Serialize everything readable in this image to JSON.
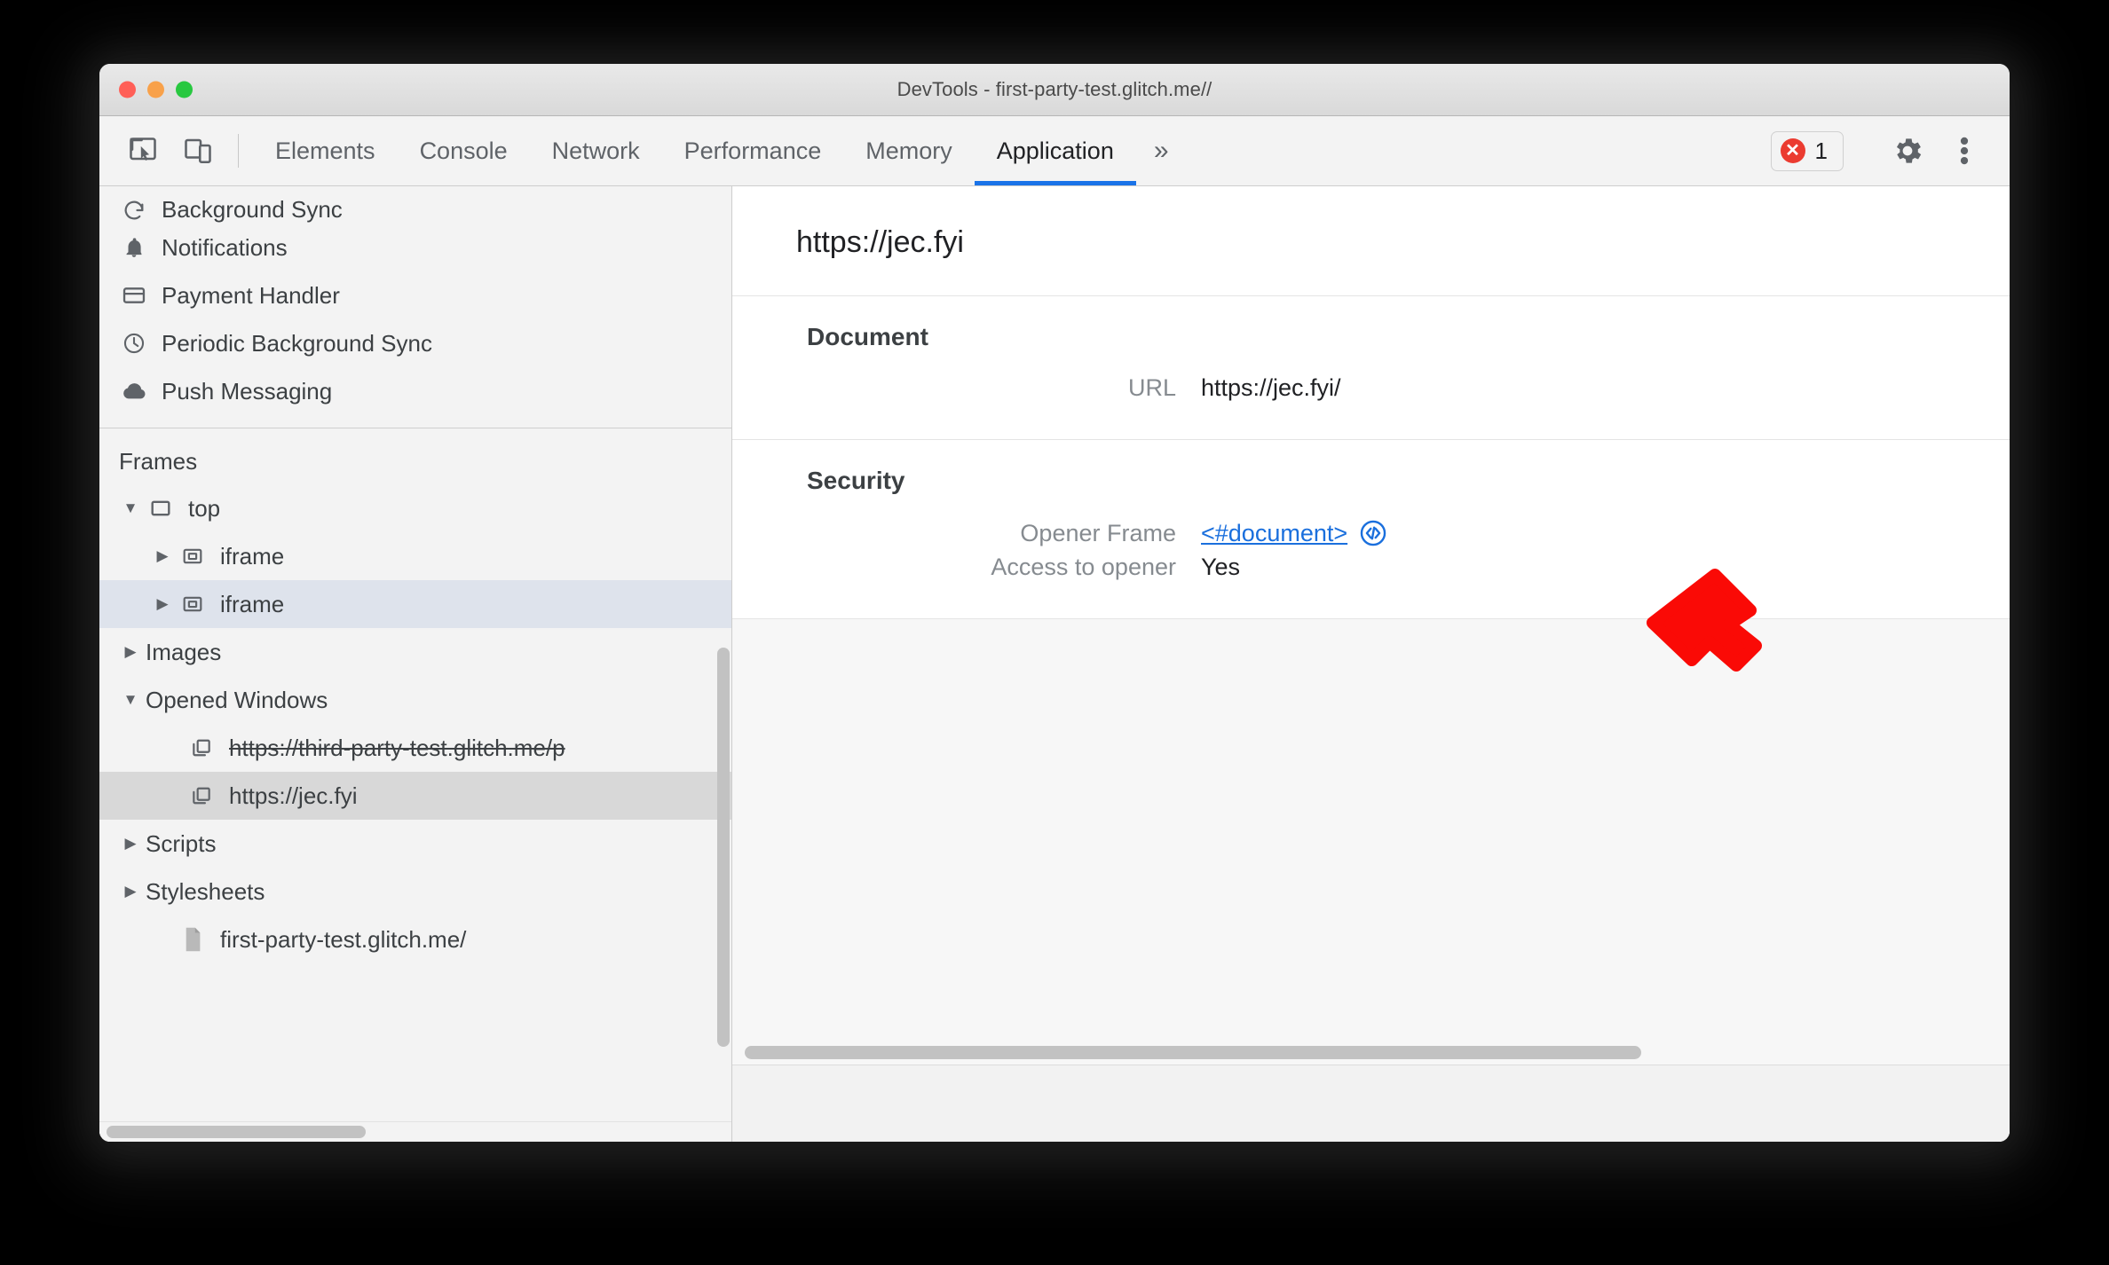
{
  "window": {
    "title": "DevTools - first-party-test.glitch.me//",
    "traffic_lights": [
      "close-button",
      "minimize-button",
      "zoom-button"
    ]
  },
  "toolbar": {
    "inspect_icon": "inspect-element-icon",
    "device_icon": "device-toolbar-icon",
    "tabs": [
      {
        "label": "Elements",
        "active": false
      },
      {
        "label": "Console",
        "active": false
      },
      {
        "label": "Network",
        "active": false
      },
      {
        "label": "Performance",
        "active": false
      },
      {
        "label": "Memory",
        "active": false
      },
      {
        "label": "Application",
        "active": true
      }
    ],
    "more_tabs_label": "»",
    "error_count": "1",
    "error_icon": "error-circle-icon",
    "settings_icon": "gear-icon",
    "menu_icon": "kebab-menu-icon",
    "accent_color": "#1a73e8",
    "error_color": "#eb3b30"
  },
  "sidebar": {
    "app_items": [
      {
        "label": "Background Sync",
        "icon": "background-sync-icon"
      },
      {
        "label": "Notifications",
        "icon": "bell-icon"
      },
      {
        "label": "Payment Handler",
        "icon": "credit-card-icon"
      },
      {
        "label": "Periodic Background Sync",
        "icon": "clock-icon"
      },
      {
        "label": "Push Messaging",
        "icon": "cloud-icon"
      }
    ],
    "frames_label": "Frames",
    "frames": [
      {
        "label": "top",
        "icon": "frame-icon",
        "twisty": "▼",
        "indent": 1,
        "selected": "none",
        "strike": false
      },
      {
        "label": "iframe",
        "icon": "iframe-icon",
        "twisty": "▶",
        "indent": 2,
        "selected": "none",
        "strike": false
      },
      {
        "label": "iframe",
        "icon": "iframe-icon",
        "twisty": "▶",
        "indent": 2,
        "selected": "blue",
        "strike": false
      },
      {
        "label": "Images",
        "icon": "none",
        "twisty": "▶",
        "indent": 1,
        "selected": "none",
        "strike": false
      },
      {
        "label": "Opened Windows",
        "icon": "none",
        "twisty": "▼",
        "indent": 1,
        "selected": "none",
        "strike": false
      },
      {
        "label": "https://third-party-test.glitch.me/p",
        "icon": "window-icon",
        "twisty": "",
        "indent": 3,
        "selected": "none",
        "strike": true
      },
      {
        "label": "https://jec.fyi",
        "icon": "window-icon",
        "twisty": "",
        "indent": 3,
        "selected": "grey",
        "strike": false
      },
      {
        "label": "Scripts",
        "icon": "none",
        "twisty": "▶",
        "indent": 1,
        "selected": "none",
        "strike": false
      },
      {
        "label": "Stylesheets",
        "icon": "none",
        "twisty": "▶",
        "indent": 1,
        "selected": "none",
        "strike": false
      },
      {
        "label": "first-party-test.glitch.me/",
        "icon": "document-icon",
        "twisty": "",
        "indent": 2,
        "selected": "none",
        "strike": false
      }
    ]
  },
  "main": {
    "frame_title": "https://jec.fyi",
    "sections": [
      {
        "heading": "Document",
        "rows": [
          {
            "key": "URL",
            "value": "https://jec.fyi/",
            "type": "text"
          }
        ]
      },
      {
        "heading": "Security",
        "rows": [
          {
            "key": "Opener Frame",
            "value": "<#document>",
            "type": "link",
            "icon": "code-circle-icon"
          },
          {
            "key": "Access to opener",
            "value": "Yes",
            "type": "text"
          }
        ]
      }
    ],
    "link_color": "#1a6fdd"
  },
  "annotation": {
    "arrow": "red-arrow-pointing-to-opener-frame-code-icon",
    "color": "#fa0a06"
  }
}
